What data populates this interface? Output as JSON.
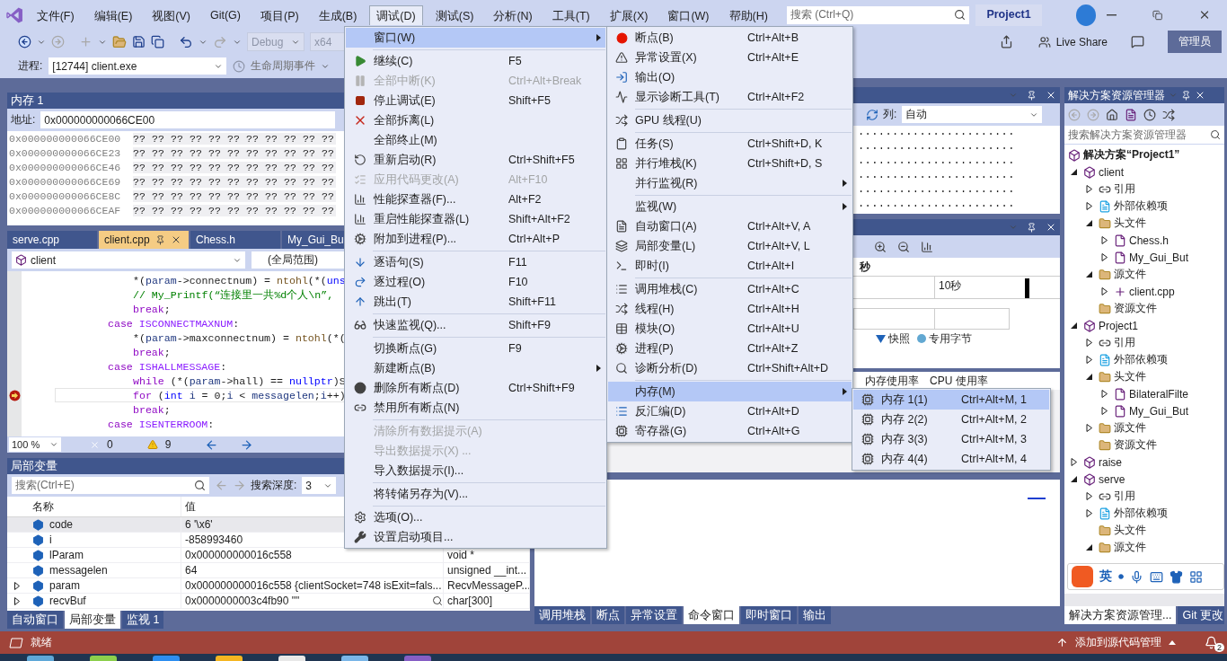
{
  "title_bar": {
    "menus": [
      {
        "label": "文件(F)",
        "selected": false
      },
      {
        "label": "编辑(E)",
        "selected": false
      },
      {
        "label": "视图(V)",
        "selected": false
      },
      {
        "label": "Git(G)",
        "selected": false
      },
      {
        "label": "项目(P)",
        "selected": false
      },
      {
        "label": "生成(B)",
        "selected": false
      },
      {
        "label": "调试(D)",
        "selected": true
      },
      {
        "label": "测试(S)",
        "selected": false
      },
      {
        "label": "分析(N)",
        "selected": false
      },
      {
        "label": "工具(T)",
        "selected": false
      },
      {
        "label": "扩展(X)",
        "selected": false
      },
      {
        "label": "窗口(W)",
        "selected": false
      },
      {
        "label": "帮助(H)",
        "selected": false
      }
    ],
    "search": {
      "placeholder": "搜索 (Ctrl+Q)"
    },
    "solution_name": "Project1"
  },
  "toolbar": {
    "configuration": "Debug",
    "platform": "x64",
    "process_label": "进程:",
    "process": "[12744] client.exe",
    "lifecycle": "生命周期事件",
    "live_share": "Live Share",
    "admin": "管理员"
  },
  "memory_panel": {
    "title": "内存 1",
    "address_label": "地址:",
    "address": "0x000000000066CE00",
    "rows": [
      {
        "address": "0x000000000066CE00",
        "bytes": "?? ?? ?? ?? ?? ?? ?? ?? ?? ?? ??"
      },
      {
        "address": "0x000000000066CE23",
        "bytes": "?? ?? ?? ?? ?? ?? ?? ?? ?? ?? ??"
      },
      {
        "address": "0x000000000066CE46",
        "bytes": "?? ?? ?? ?? ?? ?? ?? ?? ?? ?? ??"
      },
      {
        "address": "0x000000000066CE69",
        "bytes": "?? ?? ?? ?? ?? ?? ?? ?? ?? ?? ??"
      },
      {
        "address": "0x000000000066CE8C",
        "bytes": "?? ?? ?? ?? ?? ?? ?? ?? ?? ?? ??"
      },
      {
        "address": "0x000000000066CEAF",
        "bytes": "?? ?? ?? ?? ?? ?? ?? ?? ?? ?? ??"
      }
    ]
  },
  "editor": {
    "tabs": [
      {
        "label": "serve.cpp",
        "selected": false
      },
      {
        "label": "client.cpp",
        "selected": true
      },
      {
        "label": "Chess.h",
        "selected": false
      },
      {
        "label": "My_Gui_Bu",
        "selected": false
      }
    ],
    "project": "client",
    "scope": "(全局范围)",
    "lines": [
      {
        "kind": "body",
        "current": false,
        "tokens": [
          {
            "kind": "op",
            "text": "*("
          },
          {
            "kind": "var",
            "text": "param"
          },
          {
            "kind": "op",
            "text": "->connectnum) = "
          },
          {
            "kind": "fn",
            "text": "ntohl"
          },
          {
            "kind": "op",
            "text": "(*("
          },
          {
            "kind": "kw",
            "text": "uns"
          }
        ]
      },
      {
        "kind": "body",
        "current": false,
        "tokens": [
          {
            "kind": "comment",
            "text": "// My_Printf(“连接里一共%d个人\\n”,"
          }
        ]
      },
      {
        "kind": "body",
        "current": false,
        "tokens": [
          {
            "kind": "ctl",
            "text": "break"
          },
          {
            "kind": "op",
            "text": ";"
          }
        ]
      },
      {
        "kind": "label",
        "current": false,
        "tokens": [
          {
            "kind": "ctl",
            "text": "case "
          },
          {
            "kind": "macro",
            "text": "ISCONNECTMAXNUM"
          },
          {
            "kind": "op",
            "text": ":"
          }
        ]
      },
      {
        "kind": "body",
        "current": false,
        "tokens": [
          {
            "kind": "op",
            "text": "*("
          },
          {
            "kind": "var",
            "text": "param"
          },
          {
            "kind": "op",
            "text": "->maxconnectnum) = "
          },
          {
            "kind": "fn",
            "text": "ntohl"
          },
          {
            "kind": "op",
            "text": "(*("
          }
        ]
      },
      {
        "kind": "body",
        "current": false,
        "tokens": [
          {
            "kind": "ctl",
            "text": "break"
          },
          {
            "kind": "op",
            "text": ";"
          }
        ]
      },
      {
        "kind": "label",
        "current": false,
        "tokens": [
          {
            "kind": "ctl",
            "text": "case "
          },
          {
            "kind": "macro",
            "text": "ISHALLMESSAGE"
          },
          {
            "kind": "op",
            "text": ":"
          }
        ]
      },
      {
        "kind": "body",
        "current": false,
        "tokens": [
          {
            "kind": "ctl",
            "text": "while"
          },
          {
            "kind": "op",
            "text": " (*("
          },
          {
            "kind": "var",
            "text": "param"
          },
          {
            "kind": "op",
            "text": "->hall) == "
          },
          {
            "kind": "kw",
            "text": "nullptr"
          },
          {
            "kind": "op",
            "text": ")S"
          }
        ]
      },
      {
        "kind": "body",
        "current": true,
        "tokens": [
          {
            "kind": "ctl",
            "text": "for"
          },
          {
            "kind": "op",
            "text": " ("
          },
          {
            "kind": "kw",
            "text": "int "
          },
          {
            "kind": "var",
            "text": "i"
          },
          {
            "kind": "op",
            "text": " = 0;"
          },
          {
            "kind": "var",
            "text": "i"
          },
          {
            "kind": "op",
            "text": " < "
          },
          {
            "kind": "var",
            "text": "messagelen"
          },
          {
            "kind": "op",
            "text": ";"
          },
          {
            "kind": "var",
            "text": "i"
          },
          {
            "kind": "op",
            "text": "++)"
          }
        ]
      },
      {
        "kind": "body",
        "current": false,
        "tokens": [
          {
            "kind": "ctl",
            "text": "break"
          },
          {
            "kind": "op",
            "text": ";"
          }
        ]
      },
      {
        "kind": "label",
        "current": false,
        "tokens": [
          {
            "kind": "ctl",
            "text": "case "
          },
          {
            "kind": "macro",
            "text": "ISENTERROOM"
          },
          {
            "kind": "op",
            "text": ":"
          }
        ]
      }
    ],
    "zoom": "100 %",
    "errors": "0",
    "warnings": "9"
  },
  "locals_panel": {
    "title": "局部变量",
    "search": {
      "placeholder": "搜索(Ctrl+E)"
    },
    "depth_label": "搜索深度:",
    "depth": "3",
    "columns": [
      "名称",
      "值"
    ],
    "rows": [
      {
        "name": "code",
        "value": "6 '\\x6'",
        "selected": true
      },
      {
        "name": "i",
        "value": "-858993460",
        "selected": false
      },
      {
        "name": "lParam",
        "value": "0x000000000016c558",
        "type": "void *",
        "selected": false
      },
      {
        "name": "messagelen",
        "value": "64",
        "type": "unsigned __int...",
        "selected": false
      },
      {
        "name": "param",
        "value": "0x000000000016c558 {clientSocket=748 isExit=fals...",
        "type": "RecvMessageP...",
        "selected": false,
        "expanded": false
      },
      {
        "name": "recvBuf",
        "value": "0x0000000003c4fb90 \"\"",
        "type": "char[300]",
        "selected": false,
        "expanded": false
      }
    ],
    "tabs": [
      {
        "label": "自动窗口",
        "selected": false
      },
      {
        "label": "局部变量",
        "selected": true
      },
      {
        "label": "监视 1",
        "selected": false
      }
    ]
  },
  "memory2_panel": {
    "column_label": "列:",
    "columns": "自动",
    "ascii_rows": [
      ".......................",
      ".......................",
      ".......................",
      ".......................",
      ".......................",
      "......................."
    ]
  },
  "diagnostics_panel": {
    "time_label": "秒",
    "tick": "10秒",
    "legend": [
      {
        "label": "快照",
        "kind": "marker"
      },
      {
        "label": "专用字节",
        "kind": "dot"
      }
    ],
    "tabs": [
      {
        "label": "内存使用率",
        "selected": false
      },
      {
        "label": "CPU 使用率",
        "selected": false
      }
    ]
  },
  "bottom_tabs": [
    {
      "label": "调用堆栈",
      "selected": false
    },
    {
      "label": "断点",
      "selected": false
    },
    {
      "label": "异常设置",
      "selected": false
    },
    {
      "label": "命令窗口",
      "selected": true
    },
    {
      "label": "即时窗口",
      "selected": false
    },
    {
      "label": "输出",
      "selected": false
    }
  ],
  "solution_explorer": {
    "title": "解决方案资源管理器",
    "search": {
      "placeholder": "搜索解决方案资源管理器"
    },
    "tree": [
      {
        "label": "解决方案“Project1”",
        "kind": "solution",
        "children": [
          {
            "label": "client",
            "kind": "project",
            "expanded": true,
            "children": [
              {
                "label": "引用",
                "kind": "references",
                "expanded": false
              },
              {
                "label": "外部依赖项",
                "kind": "external",
                "expanded": false
              },
              {
                "label": "头文件",
                "kind": "folder",
                "expanded": true,
                "children": [
                  {
                    "label": "Chess.h",
                    "kind": "header",
                    "expanded": false
                  },
                  {
                    "label": "My_Gui_But",
                    "kind": "header",
                    "expanded": false
                  }
                ]
              },
              {
                "label": "源文件",
                "kind": "folder",
                "expanded": true,
                "children": [
                  {
                    "label": "client.cpp",
                    "kind": "source",
                    "expanded": false
                  }
                ]
              },
              {
                "label": "资源文件",
                "kind": "folder"
              }
            ]
          },
          {
            "label": "Project1",
            "kind": "project",
            "expanded": true,
            "children": [
              {
                "label": "引用",
                "kind": "references",
                "expanded": false
              },
              {
                "label": "外部依赖项",
                "kind": "external",
                "expanded": false
              },
              {
                "label": "头文件",
                "kind": "folder",
                "expanded": true,
                "children": [
                  {
                    "label": "BilateralFilte",
                    "kind": "header",
                    "expanded": false
                  },
                  {
                    "label": "My_Gui_But",
                    "kind": "header",
                    "expanded": false
                  }
                ]
              },
              {
                "label": "源文件",
                "kind": "folder",
                "expanded": false
              },
              {
                "label": "资源文件",
                "kind": "folder"
              }
            ]
          },
          {
            "label": "raise",
            "kind": "project",
            "expanded": false
          },
          {
            "label": "serve",
            "kind": "project",
            "expanded": true,
            "children": [
              {
                "label": "引用",
                "kind": "references",
                "expanded": false
              },
              {
                "label": "外部依赖项",
                "kind": "external",
                "expanded": false
              },
              {
                "label": "头文件",
                "kind": "folder"
              },
              {
                "label": "源文件",
                "kind": "folder",
                "expanded": true
              }
            ]
          }
        ]
      }
    ],
    "tabs": [
      {
        "label": "解决方案资源管理...",
        "selected": true
      },
      {
        "label": "Git 更改",
        "selected": false
      }
    ]
  },
  "ime_bar": {
    "mode": "英"
  },
  "status_bar": {
    "text": "就绪",
    "source_control": "添加到源代码管理",
    "notifications": "2"
  },
  "debug_menu": {
    "items": [
      {
        "kind": "item",
        "label": "窗口(W)",
        "submenu": true,
        "selected": true,
        "disabled": false
      },
      {
        "kind": "separator"
      },
      {
        "kind": "item",
        "label": "继续(C)",
        "shortcut": "F5",
        "selected": false,
        "disabled": false
      },
      {
        "kind": "item",
        "label": "全部中断(K)",
        "shortcut": "Ctrl+Alt+Break",
        "selected": false,
        "disabled": true
      },
      {
        "kind": "item",
        "label": "停止调试(E)",
        "shortcut": "Shift+F5",
        "selected": false,
        "disabled": false
      },
      {
        "kind": "item",
        "label": "全部拆离(L)",
        "selected": false,
        "disabled": false
      },
      {
        "kind": "item",
        "label": "全部终止(M)",
        "selected": false,
        "disabled": false
      },
      {
        "kind": "item",
        "label": "重新启动(R)",
        "shortcut": "Ctrl+Shift+F5",
        "selected": false,
        "disabled": false
      },
      {
        "kind": "item",
        "label": "应用代码更改(A)",
        "shortcut": "Alt+F10",
        "selected": false,
        "disabled": true
      },
      {
        "kind": "item",
        "label": "性能探查器(F)...",
        "shortcut": "Alt+F2",
        "selected": false,
        "disabled": false
      },
      {
        "kind": "item",
        "label": "重启性能探查器(L)",
        "shortcut": "Shift+Alt+F2",
        "selected": false,
        "disabled": false
      },
      {
        "kind": "item",
        "label": "附加到进程(P)...",
        "shortcut": "Ctrl+Alt+P",
        "selected": false,
        "disabled": false
      },
      {
        "kind": "separator"
      },
      {
        "kind": "item",
        "label": "逐语句(S)",
        "shortcut": "F11",
        "selected": false,
        "disabled": false
      },
      {
        "kind": "item",
        "label": "逐过程(O)",
        "shortcut": "F10",
        "selected": false,
        "disabled": false
      },
      {
        "kind": "item",
        "label": "跳出(T)",
        "shortcut": "Shift+F11",
        "selected": false,
        "disabled": false
      },
      {
        "kind": "separator"
      },
      {
        "kind": "item",
        "label": "快速监视(Q)...",
        "shortcut": "Shift+F9",
        "selected": false,
        "disabled": false
      },
      {
        "kind": "separator"
      },
      {
        "kind": "item",
        "label": "切换断点(G)",
        "shortcut": "F9",
        "selected": false,
        "disabled": false
      },
      {
        "kind": "item",
        "label": "新建断点(B)",
        "submenu": true,
        "selected": false,
        "disabled": false
      },
      {
        "kind": "item",
        "label": "删除所有断点(D)",
        "shortcut": "Ctrl+Shift+F9",
        "selected": false,
        "disabled": false
      },
      {
        "kind": "item",
        "label": "禁用所有断点(N)",
        "selected": false,
        "disabled": false
      },
      {
        "kind": "separator"
      },
      {
        "kind": "item",
        "label": "清除所有数据提示(A)",
        "selected": false,
        "disabled": true
      },
      {
        "kind": "item",
        "label": "导出数据提示(X) ...",
        "selected": false,
        "disabled": true
      },
      {
        "kind": "item",
        "label": "导入数据提示(I)...",
        "selected": false,
        "disabled": false
      },
      {
        "kind": "separator"
      },
      {
        "kind": "item",
        "label": "将转储另存为(V)...",
        "selected": false,
        "disabled": false
      },
      {
        "kind": "separator"
      },
      {
        "kind": "item",
        "label": "选项(O)...",
        "selected": false,
        "disabled": false
      },
      {
        "kind": "item",
        "label": "设置启动项目...",
        "selected": false,
        "disabled": false
      }
    ]
  },
  "window_menu": {
    "items": [
      {
        "kind": "item",
        "label": "断点(B)",
        "shortcut": "Ctrl+Alt+B",
        "selected": false
      },
      {
        "kind": "item",
        "label": "异常设置(X)",
        "shortcut": "Ctrl+Alt+E",
        "selected": false
      },
      {
        "kind": "item",
        "label": "输出(O)",
        "selected": false
      },
      {
        "kind": "item",
        "label": "显示诊断工具(T)",
        "shortcut": "Ctrl+Alt+F2",
        "selected": false
      },
      {
        "kind": "separator"
      },
      {
        "kind": "item",
        "label": "GPU 线程(U)",
        "selected": false
      },
      {
        "kind": "separator"
      },
      {
        "kind": "item",
        "label": "任务(S)",
        "shortcut": "Ctrl+Shift+D, K",
        "selected": false
      },
      {
        "kind": "item",
        "label": "并行堆栈(K)",
        "shortcut": "Ctrl+Shift+D, S",
        "selected": false
      },
      {
        "kind": "item",
        "label": "并行监视(R)",
        "submenu": true,
        "selected": false
      },
      {
        "kind": "separator"
      },
      {
        "kind": "item",
        "label": "监视(W)",
        "submenu": true,
        "selected": false
      },
      {
        "kind": "item",
        "label": "自动窗口(A)",
        "shortcut": "Ctrl+Alt+V, A",
        "selected": false
      },
      {
        "kind": "item",
        "label": "局部变量(L)",
        "shortcut": "Ctrl+Alt+V, L",
        "selected": false
      },
      {
        "kind": "item",
        "label": "即时(I)",
        "shortcut": "Ctrl+Alt+I",
        "selected": false
      },
      {
        "kind": "separator"
      },
      {
        "kind": "item",
        "label": "调用堆栈(C)",
        "shortcut": "Ctrl+Alt+C",
        "selected": false
      },
      {
        "kind": "item",
        "label": "线程(H)",
        "shortcut": "Ctrl+Alt+H",
        "selected": false
      },
      {
        "kind": "item",
        "label": "模块(O)",
        "shortcut": "Ctrl+Alt+U",
        "selected": false
      },
      {
        "kind": "item",
        "label": "进程(P)",
        "shortcut": "Ctrl+Alt+Z",
        "selected": false
      },
      {
        "kind": "item",
        "label": "诊断分析(D)",
        "shortcut": "Ctrl+Shift+Alt+D",
        "selected": false
      },
      {
        "kind": "separator"
      },
      {
        "kind": "item",
        "label": "内存(M)",
        "submenu": true,
        "selected": true
      },
      {
        "kind": "item",
        "label": "反汇编(D)",
        "shortcut": "Ctrl+Alt+D",
        "selected": false
      },
      {
        "kind": "item",
        "label": "寄存器(G)",
        "shortcut": "Ctrl+Alt+G",
        "selected": false
      }
    ]
  },
  "memory_menu": {
    "items": [
      {
        "kind": "item",
        "label": "内存 1(1)",
        "shortcut": "Ctrl+Alt+M, 1",
        "selected": true
      },
      {
        "kind": "item",
        "label": "内存 2(2)",
        "shortcut": "Ctrl+Alt+M, 2",
        "selected": false
      },
      {
        "kind": "item",
        "label": "内存 3(3)",
        "shortcut": "Ctrl+Alt+M, 3",
        "selected": false
      },
      {
        "kind": "item",
        "label": "内存 4(4)",
        "shortcut": "Ctrl+Alt+M, 4",
        "selected": false
      }
    ]
  }
}
